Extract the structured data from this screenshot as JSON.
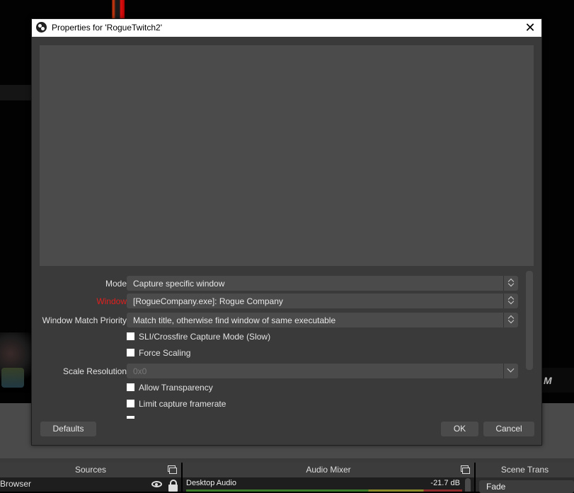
{
  "dialog": {
    "title": "Properties for 'RogueTwitch2'",
    "close_symbol": "✕",
    "properties": {
      "mode": {
        "label": "Mode",
        "value": "Capture specific window"
      },
      "window": {
        "label": "Window",
        "value": "[RogueCompany.exe]: Rogue Company",
        "label_color": "#e0201e"
      },
      "window_match_priority": {
        "label": "Window Match Priority",
        "value": "Match title, otherwise find window of same executable"
      },
      "sli_crossfire": {
        "label": "SLI/Crossfire Capture Mode (Slow)",
        "checked": false
      },
      "force_scaling": {
        "label": "Force Scaling",
        "checked": false
      },
      "scale_resolution": {
        "label": "Scale Resolution",
        "value": "0x0",
        "disabled": true
      },
      "allow_transparency": {
        "label": "Allow Transparency",
        "checked": false
      },
      "limit_framerate": {
        "label": "Limit capture framerate",
        "checked": false
      }
    },
    "buttons": {
      "defaults": "Defaults",
      "ok": "OK",
      "cancel": "Cancel"
    }
  },
  "docks": {
    "sources": {
      "title": "Sources",
      "items": [
        {
          "name": "Browser",
          "visible": true,
          "locked": true
        }
      ]
    },
    "audio_mixer": {
      "title": "Audio Mixer",
      "channels": [
        {
          "name": "Desktop Audio",
          "level": "-21.7 dB"
        }
      ]
    },
    "scene_transitions": {
      "title": "Scene Trans",
      "selected": "Fade"
    }
  },
  "background": {
    "logo_text": "M"
  }
}
